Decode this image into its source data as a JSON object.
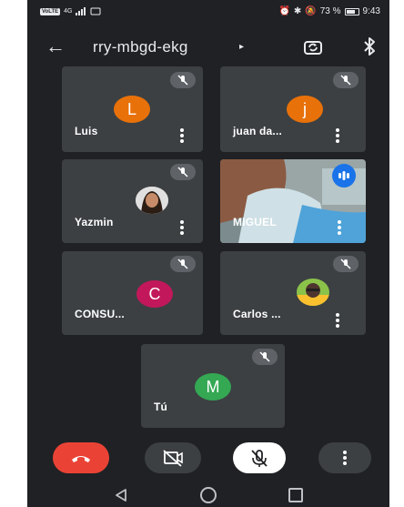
{
  "status_bar": {
    "carrier_badge": "VoLTE",
    "signal": "4G",
    "battery_pct": "73 %",
    "battery_level": 0.73,
    "time": "9:43"
  },
  "header": {
    "meeting_code": "rry-mbgd-ekg",
    "caret": "▸",
    "back_glyph": "←"
  },
  "participants": [
    {
      "name": "Luis",
      "initial": "L",
      "avatar_color": "#e8710a",
      "muted": true
    },
    {
      "name": "juan da...",
      "initial": "j",
      "avatar_color": "#e8710a",
      "muted": true
    },
    {
      "name": "Yazmin",
      "avatar": "photo",
      "muted": true
    },
    {
      "name": "MIGUEL",
      "avatar": "video",
      "speaking": true
    },
    {
      "name": "CONSU...",
      "initial": "C",
      "avatar_color": "#c2185b",
      "muted": true
    },
    {
      "name": "Carlos ...",
      "avatar": "photo",
      "muted": true
    },
    {
      "name": "Tú",
      "initial": "M",
      "avatar_color": "#34a853",
      "muted": true
    }
  ],
  "controls": {
    "end_call": "end-call",
    "camera": "camera-off",
    "microphone": "mic-off",
    "more": "more-options"
  },
  "colors": {
    "background": "#202124",
    "tile": "#3c4043",
    "end_call": "#ea4335",
    "speaking": "#1a73e8"
  }
}
